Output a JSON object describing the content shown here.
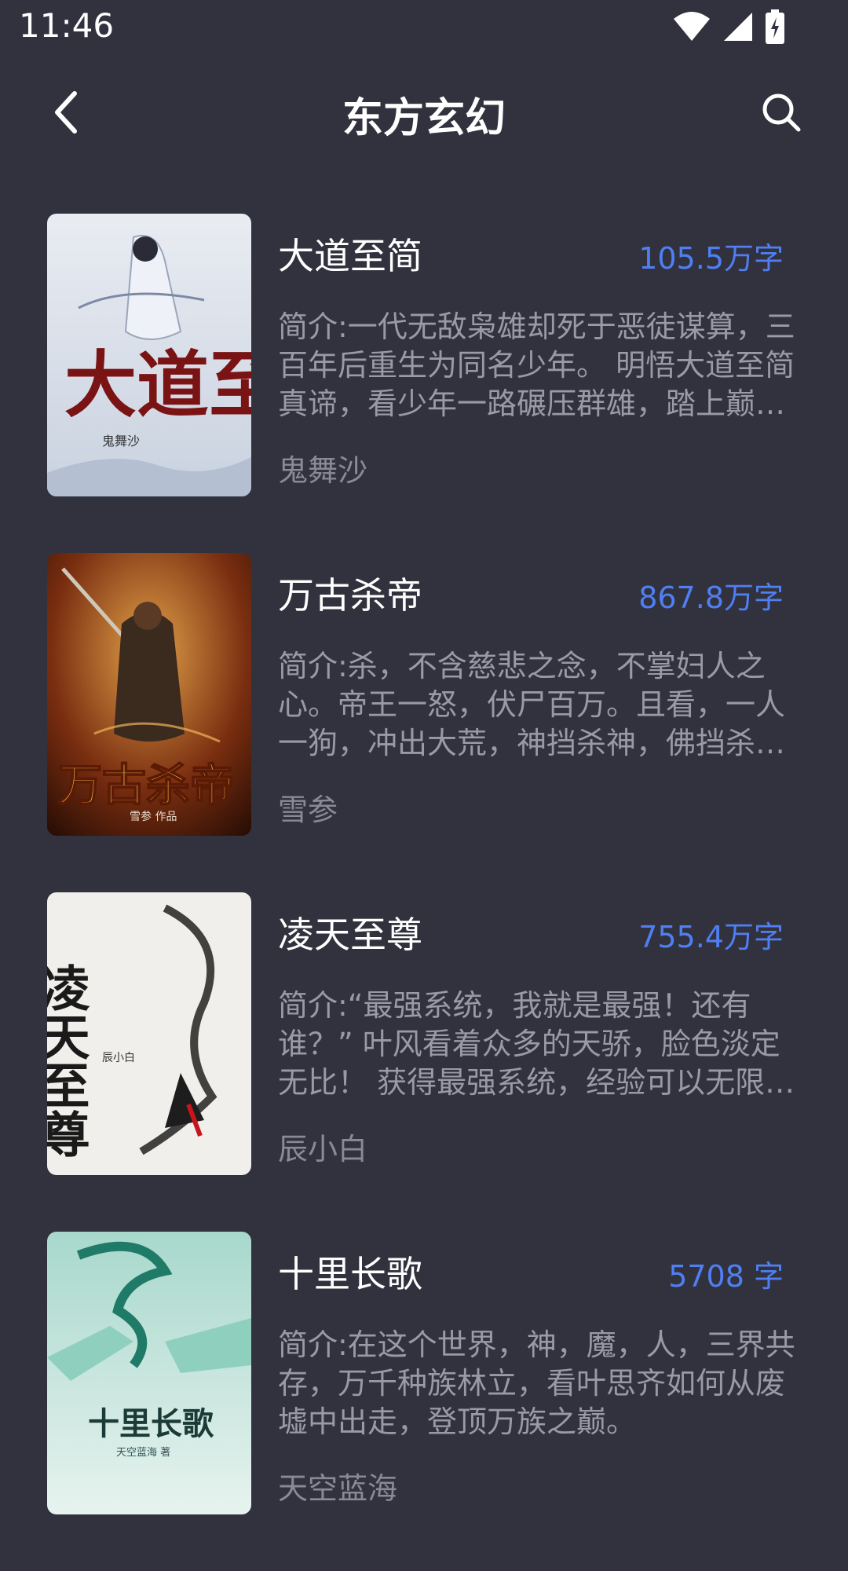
{
  "status_bar": {
    "time": "11:46"
  },
  "header": {
    "title": "东方玄幻"
  },
  "books": [
    {
      "title": "大道至简",
      "words": "105.5万字",
      "intro": "简介:一代无敌枭雄却死于恶徒谋算，三百年后重生为同名少年。 明悟大道至简真谛，看少年一路碾压群雄，踏上巅峰。",
      "author": "鬼舞沙",
      "cover_text": "大道至简",
      "cover_author": "鬼舞沙"
    },
    {
      "title": "万古杀帝",
      "words": "867.8万字",
      "intro": "简介:杀，不含慈悲之念，不掌妇人之心。帝王一怒，伏尸百万。且看，一人一狗，冲出大荒，神挡杀神，佛挡杀佛。",
      "author": "雪参",
      "cover_text": "万古杀帝",
      "cover_author": "雪参 作品"
    },
    {
      "title": "凌天至尊",
      "words": "755.4万字",
      "intro": "简介:“最强系统，我就是最强！还有谁？” 叶风看着众多的天骄，脸色淡定无比！ 获得最强系统，经验可以无限获取。",
      "author": "辰小白",
      "cover_text": "凌天至尊",
      "cover_author": "辰小白"
    },
    {
      "title": "十里长歌",
      "words": "5708 字",
      "intro": "简介:在这个世界，神，魔，人，三界共存，万千种族林立，看叶思齐如何从废墟中出走，登顶万族之巅。",
      "author": "天空蓝海",
      "cover_text": "十里长歌",
      "cover_author": "天空蓝海 著"
    }
  ],
  "colors": {
    "background": "#32323f",
    "accent": "#4f7ff2",
    "intro_text": "#9a9aa6"
  },
  "icons": [
    "back-arrow-icon",
    "search-icon",
    "wifi-icon",
    "signal-icon",
    "battery-icon"
  ]
}
